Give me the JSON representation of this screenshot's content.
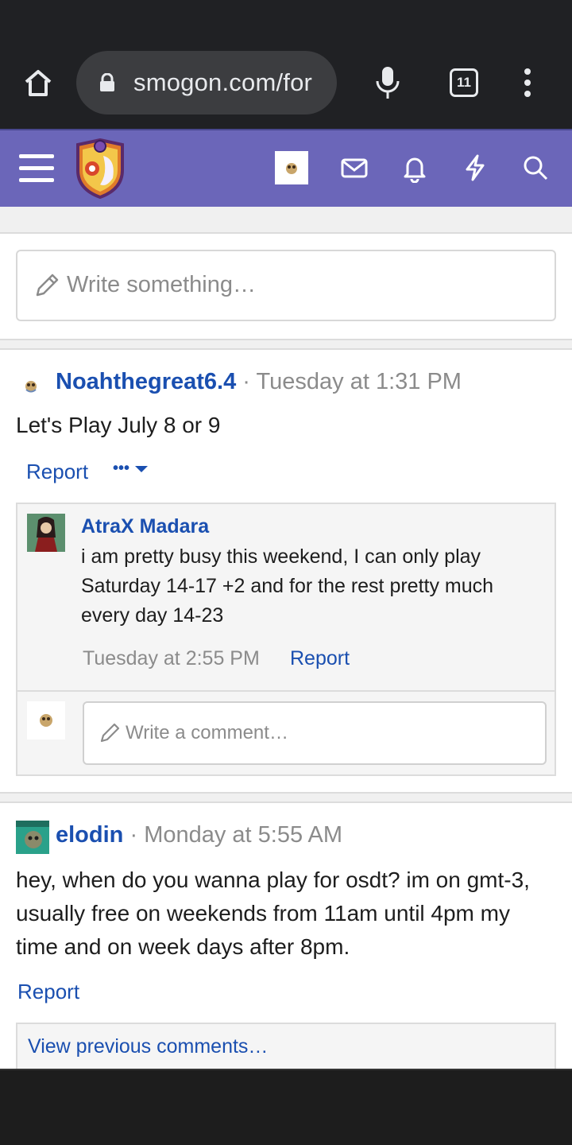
{
  "browser": {
    "url": "smogon.com/for",
    "tab_count": "11"
  },
  "compose": {
    "placeholder": "Write something…"
  },
  "posts": [
    {
      "username": "Noahthegreat6.4",
      "separator": "·",
      "time": "Tuesday at 1:31 PM",
      "text": "Let's Play July 8 or 9",
      "report_label": "Report",
      "more_label": "•••",
      "comments": [
        {
          "username": "AtraX Madara",
          "text": "i am pretty busy this weekend, I can only play Saturday 14-17 +2 and for the rest pretty much every day 14-23",
          "time": "Tuesday at 2:55 PM",
          "report_label": "Report"
        }
      ],
      "comment_placeholder": "Write a comment…"
    },
    {
      "username": "elodin",
      "separator": "·",
      "time": "Monday at 5:55 AM",
      "text": "hey, when do you wanna play for osdt? im on gmt-3, usually free on weekends from 11am until 4pm my time and on week days after 8pm.",
      "report_label": "Report",
      "view_previous_label": "View previous comments…"
    }
  ],
  "colors": {
    "header_bg": "#6b66b9",
    "link": "#1a4fb0",
    "chrome_bg": "#202124"
  }
}
